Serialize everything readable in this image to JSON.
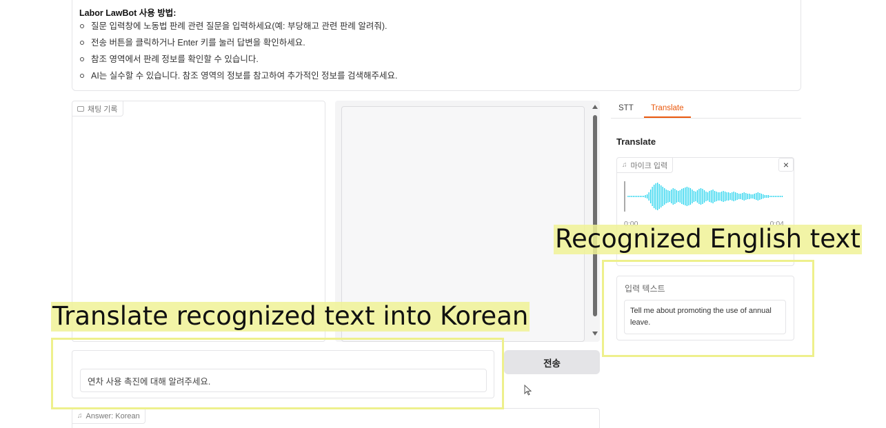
{
  "instructions": {
    "title": "Labor LawBot 사용 방법:",
    "items": [
      "질문 입력창에 노동법 판례 관련 질문을 입력하세요(예: 부당해고 관련 판례 알려줘).",
      "전송 버튼을 클릭하거나 Enter 키를 눌러 답변을 확인하세요.",
      "참조 영역에서 판례 정보를 확인할 수 있습니다.",
      "AI는 실수할 수 있습니다. 참조 영역의 정보를 참고하여 추가적인 정보를 검색해주세요."
    ]
  },
  "chat_history": {
    "label": "채팅 기록",
    "icon": "chat-icon"
  },
  "tabs": [
    {
      "label": "STT",
      "active": false
    },
    {
      "label": "Translate",
      "active": true
    }
  ],
  "translate": {
    "title": "Translate",
    "audio": {
      "label": "마이크 입력",
      "icon": "music-note-icon",
      "close_icon": "close-icon",
      "close_symbol": "×",
      "time_start": "0:00",
      "time_end": "0:04",
      "waveform_color": "#22d3ee"
    },
    "input_text": {
      "label": "입력 텍스트",
      "value": "Tell me about promoting the use of annual leave."
    }
  },
  "message": {
    "value": "연차 사용 촉진에 대해 알려주세요."
  },
  "send_button": {
    "label": "전송"
  },
  "answer": {
    "label": "Answer: Korean",
    "icon": "music-note-icon"
  },
  "annotations": {
    "right_label": "Recognized English text",
    "left_label": "Translate recognized text into Korean",
    "color": "#eef08c"
  },
  "colors": {
    "accent": "#ea580c",
    "border": "#e4e4e7",
    "button_bg": "#e4e4e7"
  }
}
